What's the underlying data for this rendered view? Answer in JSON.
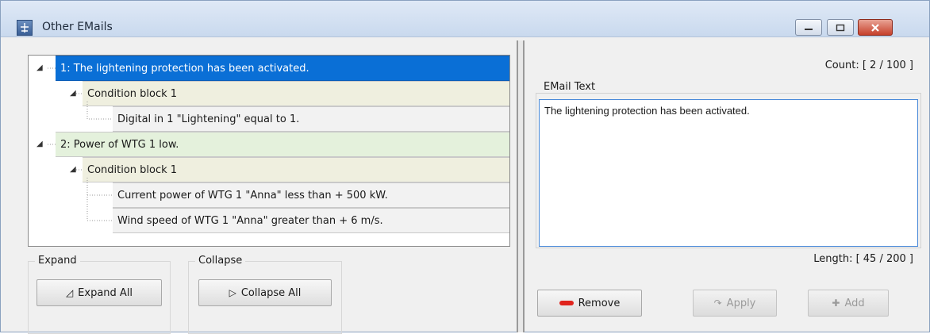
{
  "window": {
    "title": "Other EMails"
  },
  "tree": {
    "rows": [
      {
        "label": "1: The lightening protection has been activated.",
        "level": 0,
        "expanded": true,
        "style": "selected"
      },
      {
        "label": "Condition block 1",
        "level": 1,
        "expanded": true,
        "style": "beige"
      },
      {
        "label": "Digital in 1  \"Lightening\" equal to 1.",
        "level": 2,
        "style": "grey"
      },
      {
        "label": "2: Power of WTG 1 low.",
        "level": 0,
        "expanded": true,
        "style": "green"
      },
      {
        "label": "Condition block 1",
        "level": 1,
        "expanded": true,
        "style": "beige"
      },
      {
        "label": "Current power of WTG 1 \"Anna\" less than + 500 kW.",
        "level": 2,
        "style": "grey"
      },
      {
        "label": "Wind speed of WTG 1 \"Anna\" greater than + 6 m/s.",
        "level": 2,
        "style": "grey"
      }
    ]
  },
  "expand_group": {
    "label": "Expand",
    "button_label": "Expand All",
    "icon": "expand-tree-icon"
  },
  "collapse_group": {
    "label": "Collapse",
    "button_label": "Collapse All",
    "icon": "collapse-tree-icon"
  },
  "email": {
    "count": "Count: [ 2 / 100 ]",
    "text_label": "EMail Text",
    "text_value": "The lightening protection has been activated.",
    "length": "Length: [ 45 / 200 ]"
  },
  "actions": {
    "remove_label": "Remove",
    "apply_label": "Apply",
    "add_label": "Add"
  },
  "colors": {
    "selected": "#0a6fd6",
    "green_row": "#e4f1dc",
    "beige_row": "#efefdf",
    "remove_accent": "#e0241d"
  }
}
